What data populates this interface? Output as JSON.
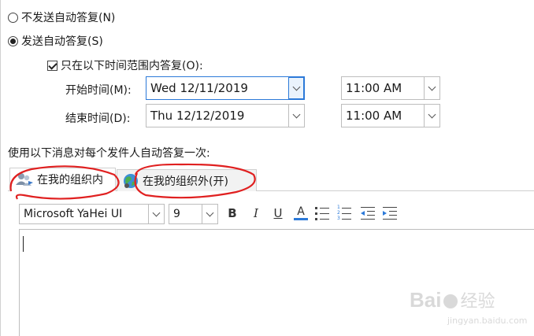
{
  "options": {
    "no_reply_label": "不发送自动答复(N)",
    "send_reply_label": "发送自动答复(S)",
    "time_range_label": "只在以下时间范围内答复(O):"
  },
  "schedule": {
    "start_label": "开始时间(M):",
    "start_date": "Wed 12/11/2019",
    "start_time": "11:00 AM",
    "end_label": "结束时间(D):",
    "end_date": "Thu 12/12/2019",
    "end_time": "11:00 AM"
  },
  "message_label": "使用以下消息对每个发件人自动答复一次:",
  "tabs": {
    "inside": "在我的组织内",
    "outside": "在我的组织外(开)"
  },
  "toolbar": {
    "font": "Microsoft YaHei UI",
    "size": "9",
    "bold": "B",
    "italic": "I",
    "underline": "U",
    "font_color": "A"
  },
  "colors": {
    "annotation": "#e02020",
    "accent": "#2b79d8"
  },
  "watermark": {
    "brand": "Bai",
    "suffix": "经验",
    "url": "jingyan.baidu.com"
  }
}
